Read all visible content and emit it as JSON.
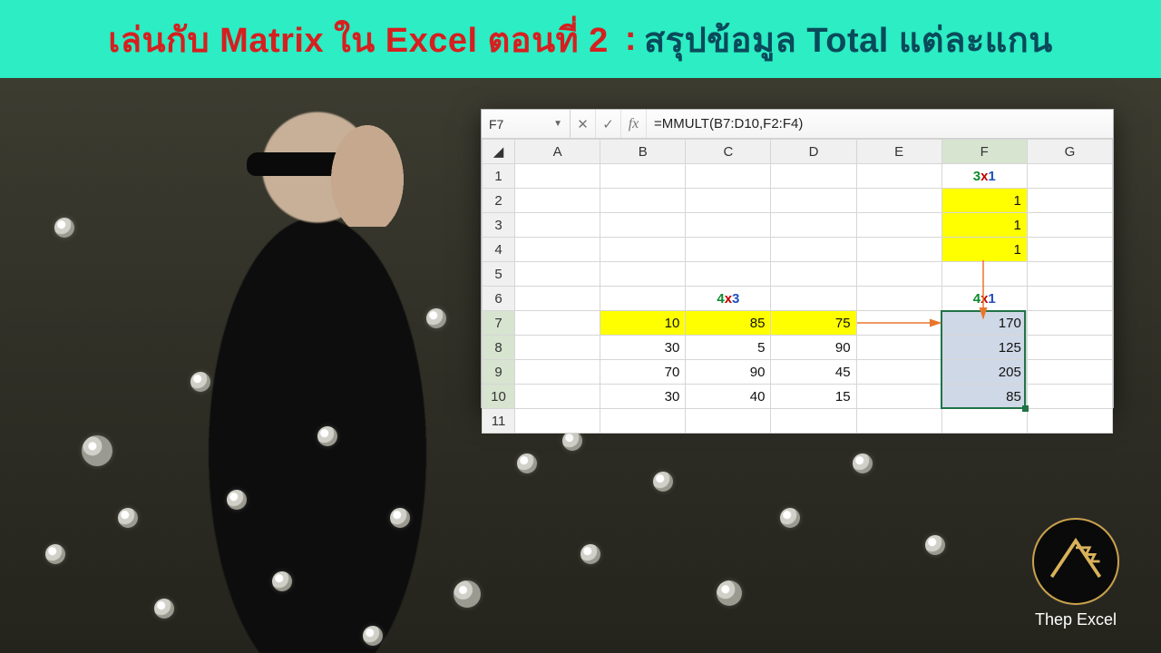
{
  "banner": {
    "part1": "เล่นกับ Matrix ใน Excel ตอนที่ 2",
    "colon": " : ",
    "part2": "สรุปข้อมูล Total แต่ละแกน"
  },
  "logo": {
    "label": "Thep Excel"
  },
  "excel": {
    "namebox": "F7",
    "formula": "=MMULT(B7:D10,F2:F4)",
    "fx_label": "fx",
    "columns": [
      "A",
      "B",
      "C",
      "D",
      "E",
      "F",
      "G"
    ],
    "row_count": 11,
    "dims": {
      "f1_a": "3",
      "f1_x": "x",
      "f1_b": "1",
      "c6_a": "4",
      "c6_x": "x",
      "c6_b": "3",
      "f6_a": "4",
      "f6_x": "x",
      "f6_b": "1"
    },
    "vec_f": {
      "r2": "1",
      "r3": "1",
      "r4": "1"
    },
    "matrix": {
      "r7": {
        "b": "10",
        "c": "85",
        "d": "75"
      },
      "r8": {
        "b": "30",
        "c": "5",
        "d": "90"
      },
      "r9": {
        "b": "70",
        "c": "90",
        "d": "45"
      },
      "r10": {
        "b": "30",
        "c": "40",
        "d": "15"
      }
    },
    "result": {
      "r7": "170",
      "r8": "125",
      "r9": "205",
      "r10": "85"
    }
  }
}
